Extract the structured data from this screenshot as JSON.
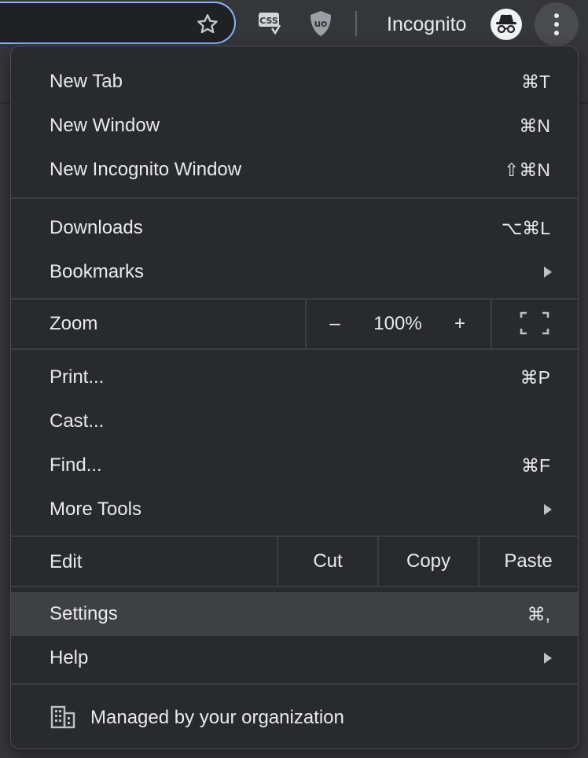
{
  "toolbar": {
    "css_extension_label": "CSS",
    "ublock_extension_label": "uo",
    "incognito_label": "Incognito"
  },
  "menu": {
    "new_tab": {
      "label": "New Tab",
      "shortcut": "⌘T"
    },
    "new_window": {
      "label": "New Window",
      "shortcut": "⌘N"
    },
    "new_incognito_window": {
      "label": "New Incognito Window",
      "shortcut": "⇧⌘N"
    },
    "downloads": {
      "label": "Downloads",
      "shortcut": "⌥⌘L"
    },
    "bookmarks": {
      "label": "Bookmarks"
    },
    "zoom": {
      "label": "Zoom",
      "minus": "–",
      "value": "100%",
      "plus": "+"
    },
    "print": {
      "label": "Print...",
      "shortcut": "⌘P"
    },
    "cast": {
      "label": "Cast..."
    },
    "find": {
      "label": "Find...",
      "shortcut": "⌘F"
    },
    "more_tools": {
      "label": "More Tools"
    },
    "edit": {
      "label": "Edit",
      "cut": "Cut",
      "copy": "Copy",
      "paste": "Paste"
    },
    "settings": {
      "label": "Settings",
      "shortcut": "⌘,"
    },
    "help": {
      "label": "Help"
    },
    "managed": {
      "label": "Managed by your organization"
    }
  },
  "icons": {
    "bookmark_star": "star-outline-icon",
    "css_extension": "css-extension-icon",
    "ublock_extension": "ublock-shield-icon",
    "incognito_avatar": "incognito-icon",
    "menu_button": "three-dot-menu-icon",
    "submenu_arrow": "chevron-right-icon",
    "fullscreen": "fullscreen-icon",
    "managed": "building-icon"
  },
  "colors": {
    "menu_background": "#292a2d",
    "highlight": "#3f4043",
    "text": "#e8eaed",
    "omnibox_focus_ring": "#8ab4f8"
  }
}
